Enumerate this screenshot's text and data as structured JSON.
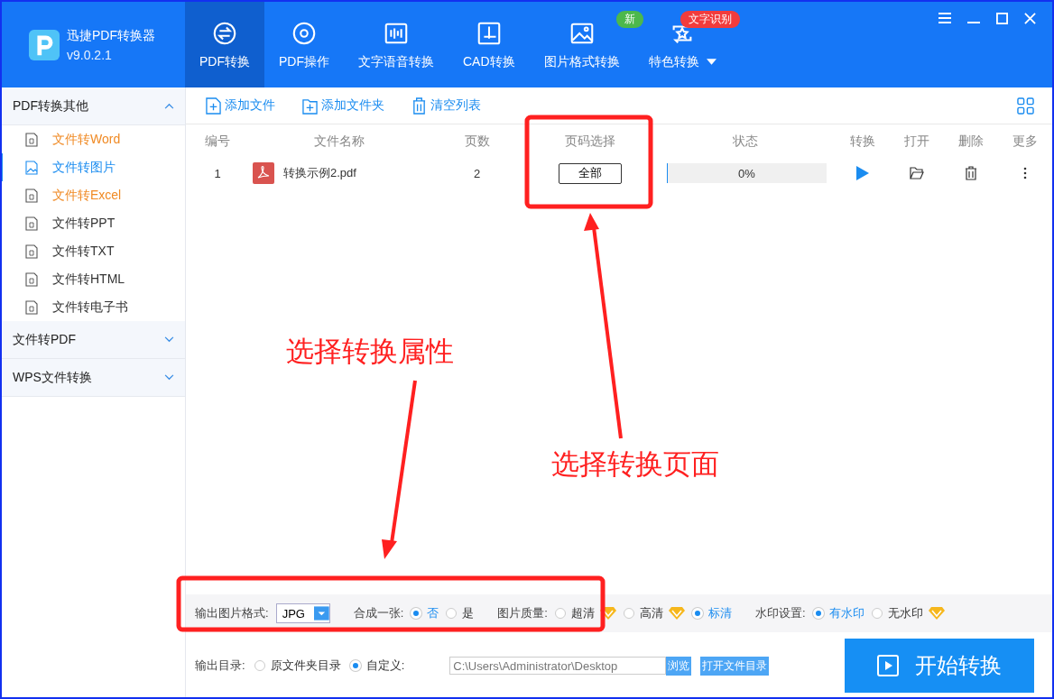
{
  "app": {
    "name": "迅捷PDF转换器",
    "version": "v9.0.2.1"
  },
  "nav_tabs": [
    {
      "label": "PDF转换",
      "selected": true
    },
    {
      "label": "PDF操作",
      "selected": false
    },
    {
      "label": "文字语音转换",
      "selected": false
    },
    {
      "label": "CAD转换",
      "selected": false
    },
    {
      "label": "图片格式转换",
      "selected": false,
      "badge": {
        "text": "新",
        "color": "#4cb84c"
      }
    },
    {
      "label": "特色转换",
      "selected": false,
      "badge": {
        "text": "文字识别",
        "color": "#f23c3c"
      },
      "dropdown": true
    }
  ],
  "sidebar": {
    "groups": [
      {
        "label": "PDF转换其他",
        "expanded": true,
        "items": [
          {
            "label": "文件转Word",
            "selected": false,
            "color": "#f08a24"
          },
          {
            "label": "文件转图片",
            "selected": true,
            "color": "#1a8cf0"
          },
          {
            "label": "文件转Excel",
            "selected": false,
            "color": "#f08a24"
          },
          {
            "label": "文件转PPT",
            "selected": false,
            "color": "#333333"
          },
          {
            "label": "文件转TXT",
            "selected": false,
            "color": "#333333"
          },
          {
            "label": "文件转HTML",
            "selected": false,
            "color": "#333333"
          },
          {
            "label": "文件转电子书",
            "selected": false,
            "color": "#333333"
          }
        ]
      },
      {
        "label": "文件转PDF",
        "expanded": false
      },
      {
        "label": "WPS文件转换",
        "expanded": false
      }
    ]
  },
  "toolbar": [
    "添加文件",
    "添加文件夹",
    "清空列表"
  ],
  "table": {
    "columns": [
      "编号",
      "文件名称",
      "页数",
      "页码选择",
      "状态",
      "转换",
      "打开",
      "删除",
      "更多"
    ],
    "rows": [
      {
        "index": "1",
        "name": "转换示例2.pdf",
        "pages": "2",
        "page_choice": "全部",
        "status": "0%",
        "level": 0
      }
    ]
  },
  "options": [
    {
      "kind": "select",
      "label": "输出图片格式:",
      "value": "JPG"
    },
    {
      "kind": "radio",
      "label": "合成一张:",
      "choices": [
        {
          "label": "否",
          "selected": true,
          "premium": false
        },
        {
          "label": "是",
          "selected": false,
          "premium": false
        }
      ]
    },
    {
      "kind": "radio",
      "label": "图片质量:",
      "choices": [
        {
          "label": "超清",
          "selected": false,
          "premium": true
        },
        {
          "label": "高清",
          "selected": false,
          "premium": true
        },
        {
          "label": "标清",
          "selected": true,
          "premium": false
        }
      ]
    },
    {
      "kind": "radio",
      "label": "水印设置:",
      "choices": [
        {
          "label": "有水印",
          "selected": true,
          "premium": false
        },
        {
          "label": "无水印",
          "selected": false,
          "premium": true
        }
      ]
    }
  ],
  "output": {
    "label": "输出目录:",
    "choices": [
      {
        "label": "原文件夹目录",
        "selected": false
      },
      {
        "label": "自定义:",
        "selected": true
      }
    ],
    "path": "C:\\Users\\Administrator\\Desktop",
    "browse": "浏览",
    "open_folder": "打开文件目录",
    "start": "开始转换"
  },
  "annotations": [
    "选择转换属性",
    "选择转换页面"
  ]
}
